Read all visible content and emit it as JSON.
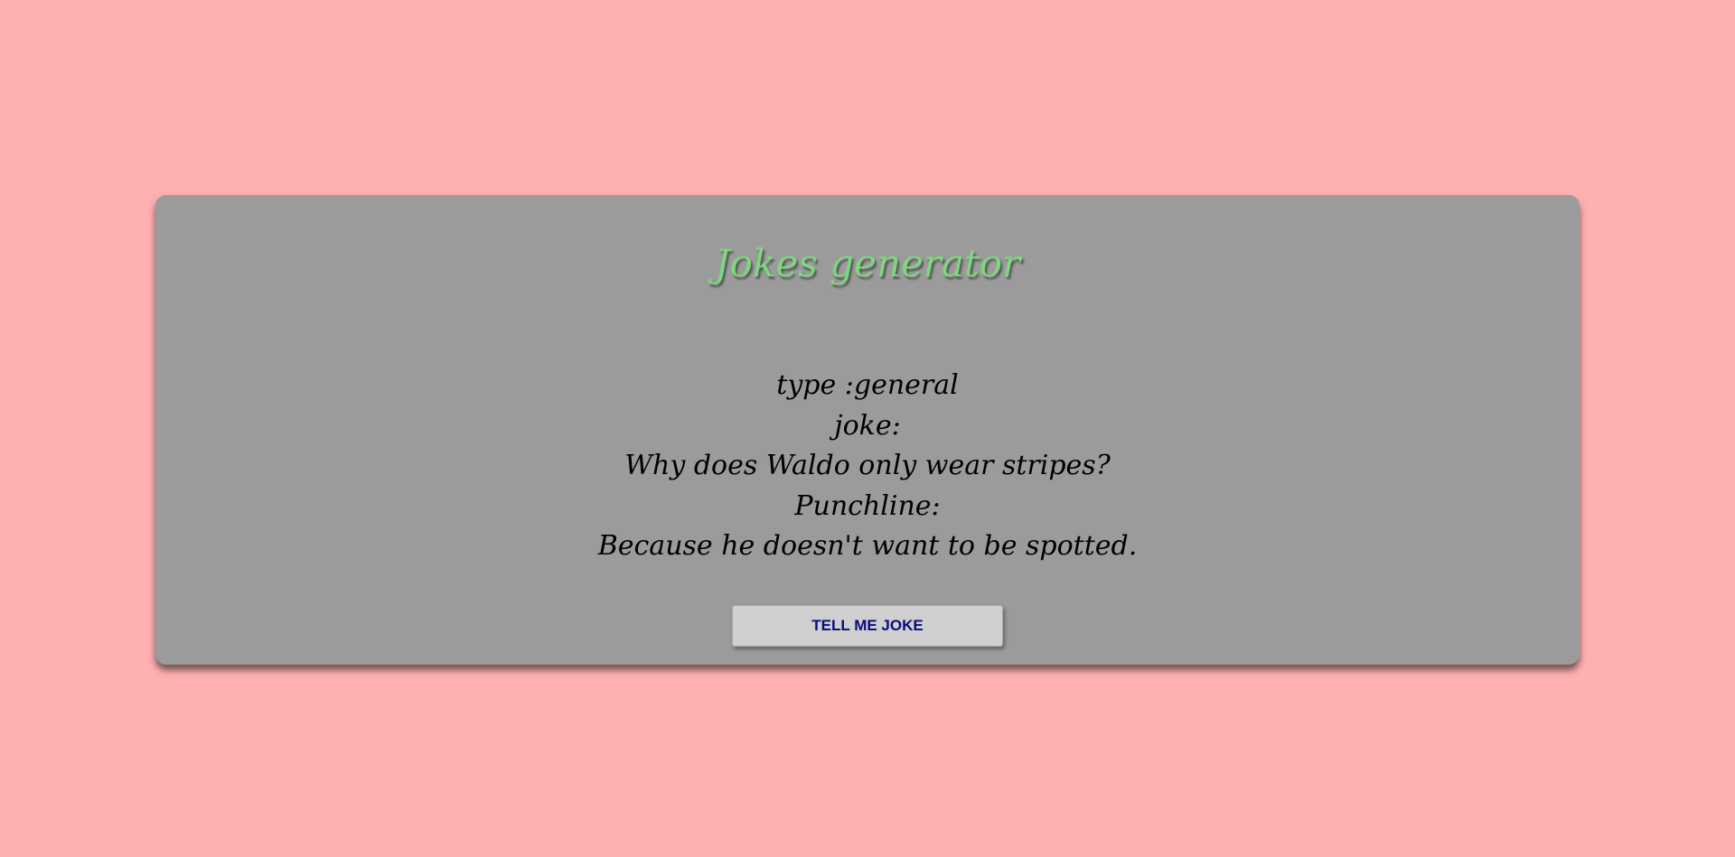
{
  "page": {
    "background_color": "#ffb1b1",
    "card_color": "#9b9b9b"
  },
  "header": {
    "title": "Jokes generator",
    "title_color": "#7ed67e"
  },
  "joke": {
    "type_line": "type :general",
    "joke_label": "joke:",
    "setup": "Why does Waldo only wear stripes?",
    "punchline_label": "Punchline:",
    "punchline": "Because he doesn't want to be spotted."
  },
  "actions": {
    "tell_joke_label": "TELL ME JOKE",
    "button_text_color": "#0b0b7c"
  }
}
